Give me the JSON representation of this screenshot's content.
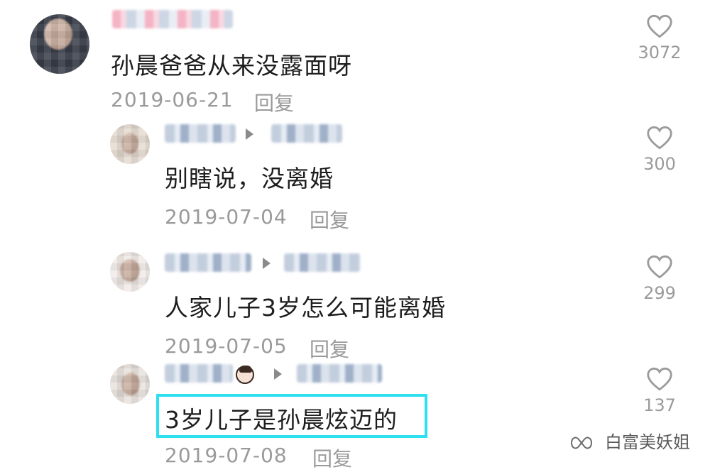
{
  "comments": [
    {
      "text": "孙晨爸爸从来没露面呀",
      "date": "2019-06-21",
      "reply_label": "回复",
      "likes": "3072",
      "heart_icon": "heart-outline-icon"
    },
    {
      "text": "别瞎说，没离婚",
      "date": "2019-07-04",
      "reply_label": "回复",
      "likes": "300",
      "heart_icon": "heart-outline-icon"
    },
    {
      "text": "人家儿子3岁怎么可能离婚",
      "date": "2019-07-05",
      "reply_label": "回复",
      "likes": "299",
      "heart_icon": "heart-outline-icon"
    },
    {
      "text": "3岁儿子是孙晨炫迈的",
      "date": "2019-07-08",
      "reply_label": "回复",
      "likes": "137",
      "heart_icon": "heart-outline-icon"
    }
  ],
  "watermark": {
    "text": "白富美妖姐",
    "icon": "wechat-channel-icon"
  },
  "colors": {
    "highlight": "#2ee0ef",
    "text": "#1d1d1d",
    "meta": "#9a9a9a"
  }
}
